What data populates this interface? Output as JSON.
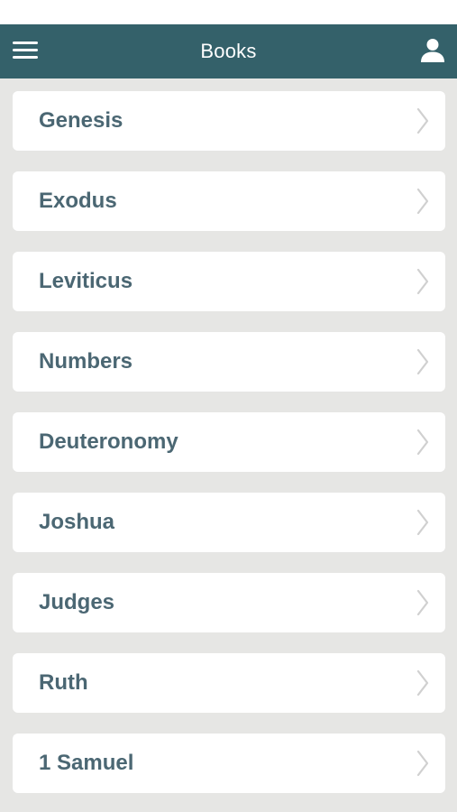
{
  "header": {
    "title": "Books",
    "menu_icon": "hamburger-menu-icon",
    "profile_icon": "user-icon",
    "background_color": "#34616a"
  },
  "books": [
    {
      "label": "Genesis"
    },
    {
      "label": "Exodus"
    },
    {
      "label": "Leviticus"
    },
    {
      "label": "Numbers"
    },
    {
      "label": "Deuteronomy"
    },
    {
      "label": "Joshua"
    },
    {
      "label": "Judges"
    },
    {
      "label": "Ruth"
    },
    {
      "label": "1 Samuel"
    }
  ],
  "colors": {
    "page_background": "#e6e6e4",
    "row_background": "#ffffff",
    "row_text": "#4b6773",
    "chevron": "#d0d0d0"
  }
}
